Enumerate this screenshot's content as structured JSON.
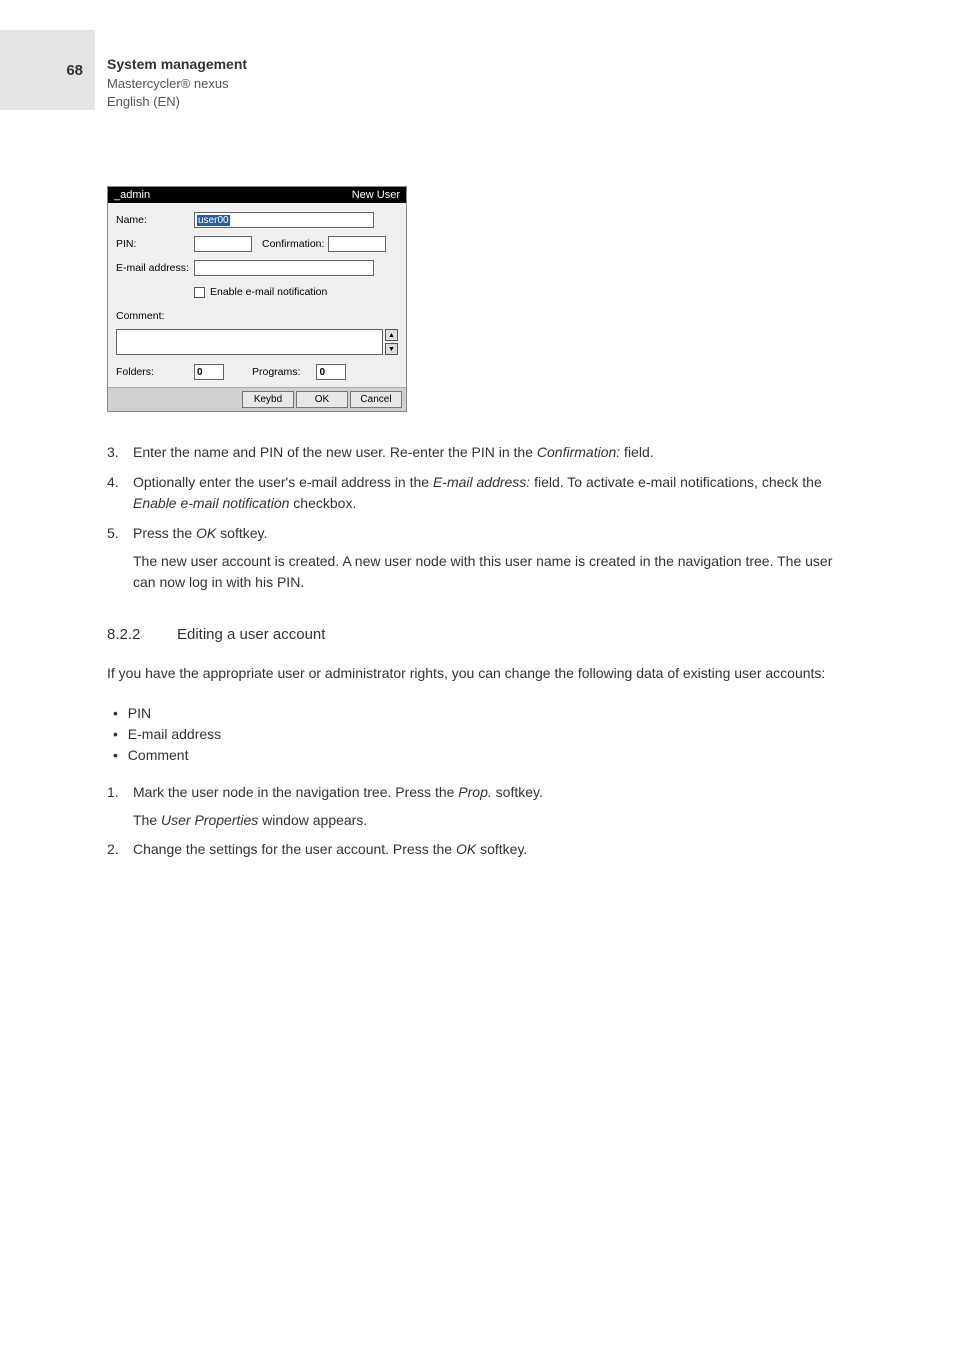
{
  "page": {
    "number": "68"
  },
  "header": {
    "title": "System management",
    "product": "Mastercycler® nexus",
    "lang": "English (EN)"
  },
  "dialog": {
    "titleLeft": "_admin",
    "titleRight": "New User",
    "labels": {
      "name": "Name:",
      "pin": "PIN:",
      "confirmation": "Confirmation:",
      "email": "E-mail address:",
      "enableEmail": "Enable e-mail notification",
      "comment": "Comment:",
      "folders": "Folders:",
      "programs": "Programs:"
    },
    "values": {
      "name": "user00",
      "folders": "0",
      "programs": "0"
    },
    "buttons": {
      "keybd": "Keybd",
      "ok": "OK",
      "cancel": "Cancel"
    }
  },
  "steps1": [
    {
      "num": "3.",
      "text_a": "Enter the name and PIN of the new user. Re-enter the PIN in the ",
      "ital_a": "Confirmation:",
      "text_b": " field."
    },
    {
      "num": "4.",
      "text_a": "Optionally enter the user's e-mail address in the ",
      "ital_a": "E-mail address:",
      "text_b": " field. To activate e-mail notifications, check the ",
      "ital_b": "Enable e-mail notification",
      "text_c": " checkbox."
    },
    {
      "num": "5.",
      "text_a": "Press the ",
      "ital_a": "OK",
      "text_b": " softkey.",
      "para2": "The new user account is created. A new user node with this user name is created in the navigation tree. The user can now log in with his PIN."
    }
  ],
  "section": {
    "num": "8.2.2",
    "title": "Editing a user account"
  },
  "para1": "If you have the appropriate user or administrator rights, you can change the following data of existing user accounts:",
  "bullets": [
    "PIN",
    "E-mail address",
    "Comment"
  ],
  "steps2": [
    {
      "num": "1.",
      "text_a": "Mark the user node in the navigation tree. Press the ",
      "ital_a": "Prop.",
      "text_b": " softkey.",
      "para2_a": "The ",
      "para2_ital": "User Properties",
      "para2_b": " window appears."
    },
    {
      "num": "2.",
      "text_a": "Change the settings for the user account. Press the ",
      "ital_a": "OK",
      "text_b": " softkey."
    }
  ]
}
